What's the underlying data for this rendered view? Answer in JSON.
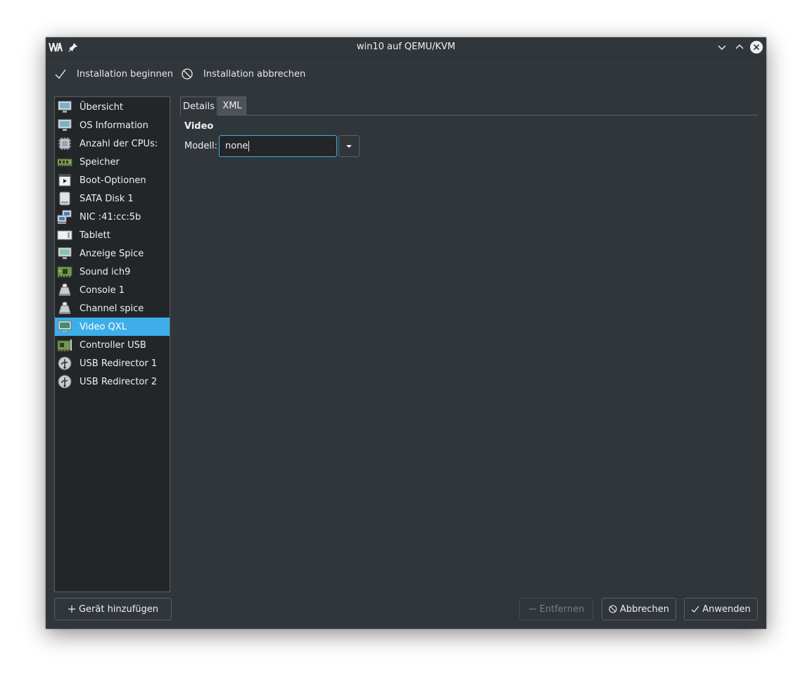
{
  "window": {
    "title": "win10 auf QEMU/KVM"
  },
  "toolbar": {
    "install_begin": "Installation beginnen",
    "install_abort": "Installation abbrechen"
  },
  "sidebar": {
    "items": [
      {
        "label": "Übersicht",
        "icon": "monitor-icon"
      },
      {
        "label": "OS Information",
        "icon": "monitor-info-icon"
      },
      {
        "label": "Anzahl der CPUs:",
        "icon": "cpu-icon"
      },
      {
        "label": "Speicher",
        "icon": "memory-icon"
      },
      {
        "label": "Boot-Optionen",
        "icon": "boot-icon"
      },
      {
        "label": "SATA Disk 1",
        "icon": "disk-icon"
      },
      {
        "label": "NIC :41:cc:5b",
        "icon": "network-icon"
      },
      {
        "label": "Tablett",
        "icon": "tablet-icon"
      },
      {
        "label": "Anzeige Spice",
        "icon": "display-icon"
      },
      {
        "label": "Sound ich9",
        "icon": "sound-card-icon"
      },
      {
        "label": "Console 1",
        "icon": "serial-icon"
      },
      {
        "label": "Channel spice",
        "icon": "channel-icon"
      },
      {
        "label": "Video QXL",
        "icon": "video-icon"
      },
      {
        "label": "Controller USB",
        "icon": "controller-icon"
      },
      {
        "label": "USB Redirector 1",
        "icon": "usb-icon"
      },
      {
        "label": "USB Redirector 2",
        "icon": "usb-icon"
      }
    ],
    "selected_label": "Video QXL"
  },
  "tabs": {
    "details": "Details",
    "xml": "XML"
  },
  "video": {
    "section_title": "Video",
    "model_label": "Modell:",
    "model_value": "none"
  },
  "buttons": {
    "add_device": "Gerät hinzufügen",
    "remove": "Entfernen",
    "cancel": "Abbrechen",
    "apply": "Anwenden"
  },
  "colors": {
    "window_bg": "#31363b",
    "sidebar_bg": "#232629",
    "accent": "#3daee9",
    "border": "#5a6066",
    "text": "#eff0f1",
    "disabled_text": "#7a7e82"
  }
}
